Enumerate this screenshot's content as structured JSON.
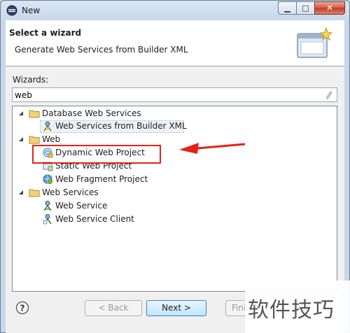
{
  "window": {
    "title": "New"
  },
  "banner": {
    "title": "Select a wizard",
    "description": "Generate Web Services from Builder XML"
  },
  "wizards_label": "Wizards:",
  "filter": {
    "value": "web"
  },
  "tree": [
    {
      "label": "Database Web Services",
      "type": "folder",
      "expanded": true
    },
    {
      "label": "Web Services from Builder XML",
      "type": "item",
      "icon": "ws-builder-icon",
      "selected": true
    },
    {
      "label": "Web",
      "type": "folder",
      "expanded": true
    },
    {
      "label": "Dynamic Web Project",
      "type": "item",
      "icon": "dynamic-web-project-icon"
    },
    {
      "label": "Static Web Project",
      "type": "item",
      "icon": "static-web-project-icon"
    },
    {
      "label": "Web Fragment Project",
      "type": "item",
      "icon": "web-fragment-project-icon"
    },
    {
      "label": "Web Services",
      "type": "folder",
      "expanded": true
    },
    {
      "label": "Web Service",
      "type": "item",
      "icon": "web-service-icon"
    },
    {
      "label": "Web Service Client",
      "type": "item",
      "icon": "web-service-client-icon"
    }
  ],
  "buttons": {
    "back": "< Back",
    "next": "Next >",
    "finish": "Finis"
  },
  "watermark": "软件技巧",
  "colors": {
    "annotation": "#e2231a",
    "folder": "#e6c15f"
  }
}
